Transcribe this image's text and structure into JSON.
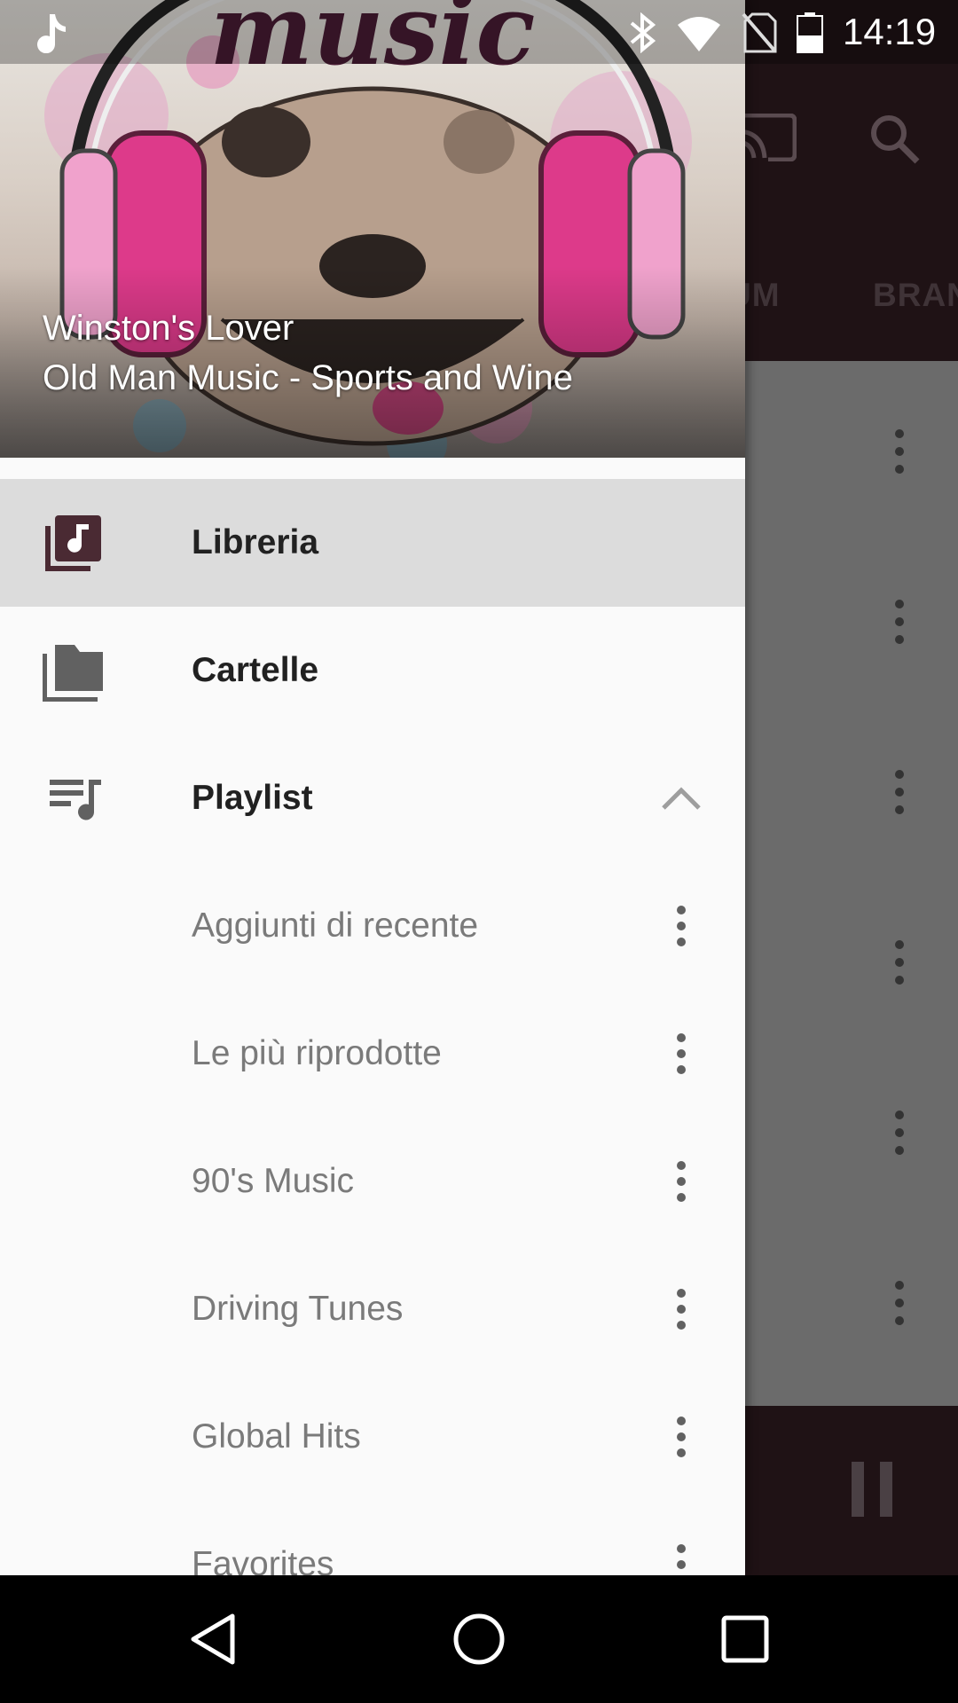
{
  "status_bar": {
    "time": "14:19",
    "icons": [
      "music-note-icon",
      "bluetooth-icon",
      "wifi-icon",
      "no-sim-icon",
      "battery-icon"
    ]
  },
  "background": {
    "tabs": [
      "UM",
      "BRAN"
    ],
    "icons": [
      "cast-icon",
      "search-icon",
      "more-vert-icon",
      "pause-icon"
    ]
  },
  "drawer": {
    "header": {
      "art_text": "music",
      "title": "Winston's Lover",
      "subtitle": "Old Man Music - Sports and Wine"
    },
    "nav": [
      {
        "label": "Libreria",
        "icon": "library-music-icon",
        "active": true
      },
      {
        "label": "Cartelle",
        "icon": "folder-icon",
        "active": false
      },
      {
        "label": "Playlist",
        "icon": "playlist-icon",
        "active": false,
        "expanded": true
      }
    ],
    "playlists": [
      "Aggiunti di recente",
      "Le più riprodotte",
      "90's Music",
      "Driving Tunes",
      "Global Hits",
      "Favorites"
    ]
  },
  "navigation_bar": {
    "buttons": [
      "back-icon",
      "home-icon",
      "recents-icon"
    ]
  },
  "colors": {
    "accent": "#4a2a33",
    "drawer_bg": "#fafafa",
    "active_item_bg": "#dcdcdc",
    "playlist_text": "#7a7a7a"
  }
}
